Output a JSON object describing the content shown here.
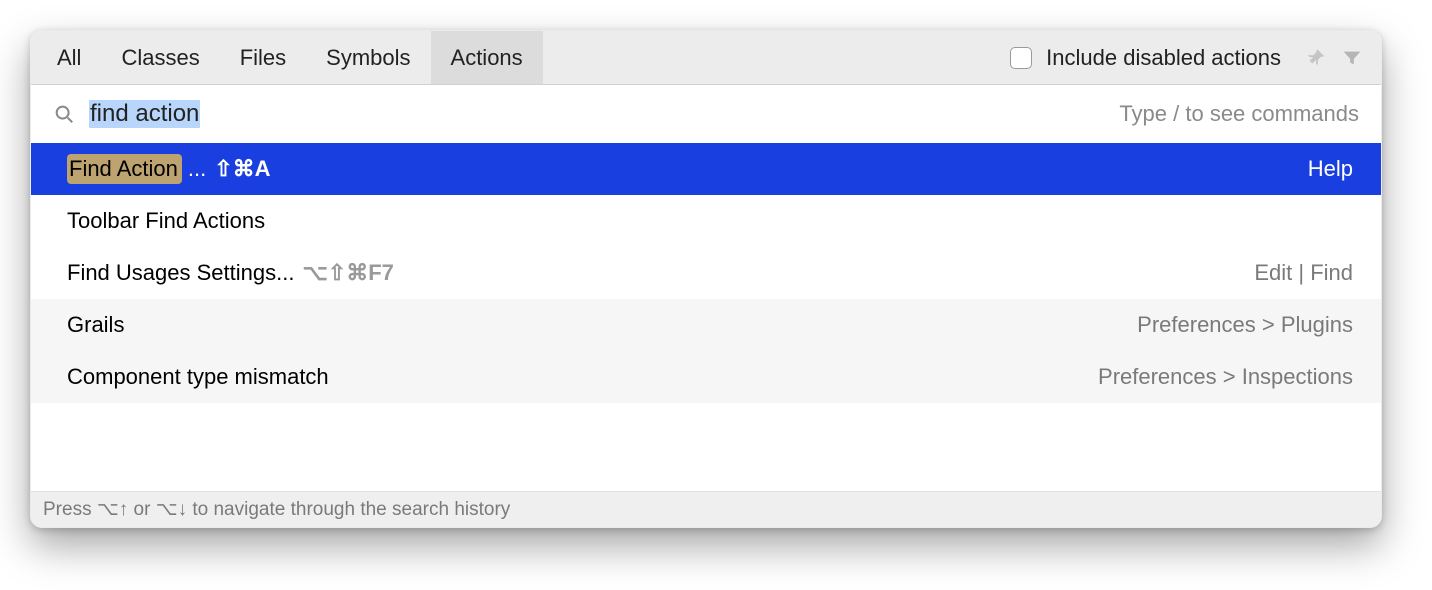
{
  "tabs": {
    "all": "All",
    "classes": "Classes",
    "files": "Files",
    "symbols": "Symbols",
    "actions": "Actions"
  },
  "toolbar": {
    "include_disabled_label": "Include disabled actions"
  },
  "search": {
    "value": "find action",
    "hint": "Type / to see commands"
  },
  "results": [
    {
      "highlight": "Find Action",
      "suffix": "...",
      "shortcut": "⇧⌘A",
      "right": "Help",
      "selected": true
    },
    {
      "label": "Toolbar Find Actions",
      "right": ""
    },
    {
      "label": "Find Usages Settings...",
      "shortcut": "⌥⇧⌘F7",
      "shortcut_dim": true,
      "right": "Edit | Find",
      "right_dim": true
    },
    {
      "label": "Grails",
      "right": "Preferences > Plugins",
      "right_dim": true,
      "alt": true
    },
    {
      "label": "Component type mismatch",
      "right": "Preferences > Inspections",
      "right_dim": true,
      "alt": true
    }
  ],
  "footer": {
    "hint": "Press ⌥↑ or ⌥↓ to navigate through the search history"
  }
}
